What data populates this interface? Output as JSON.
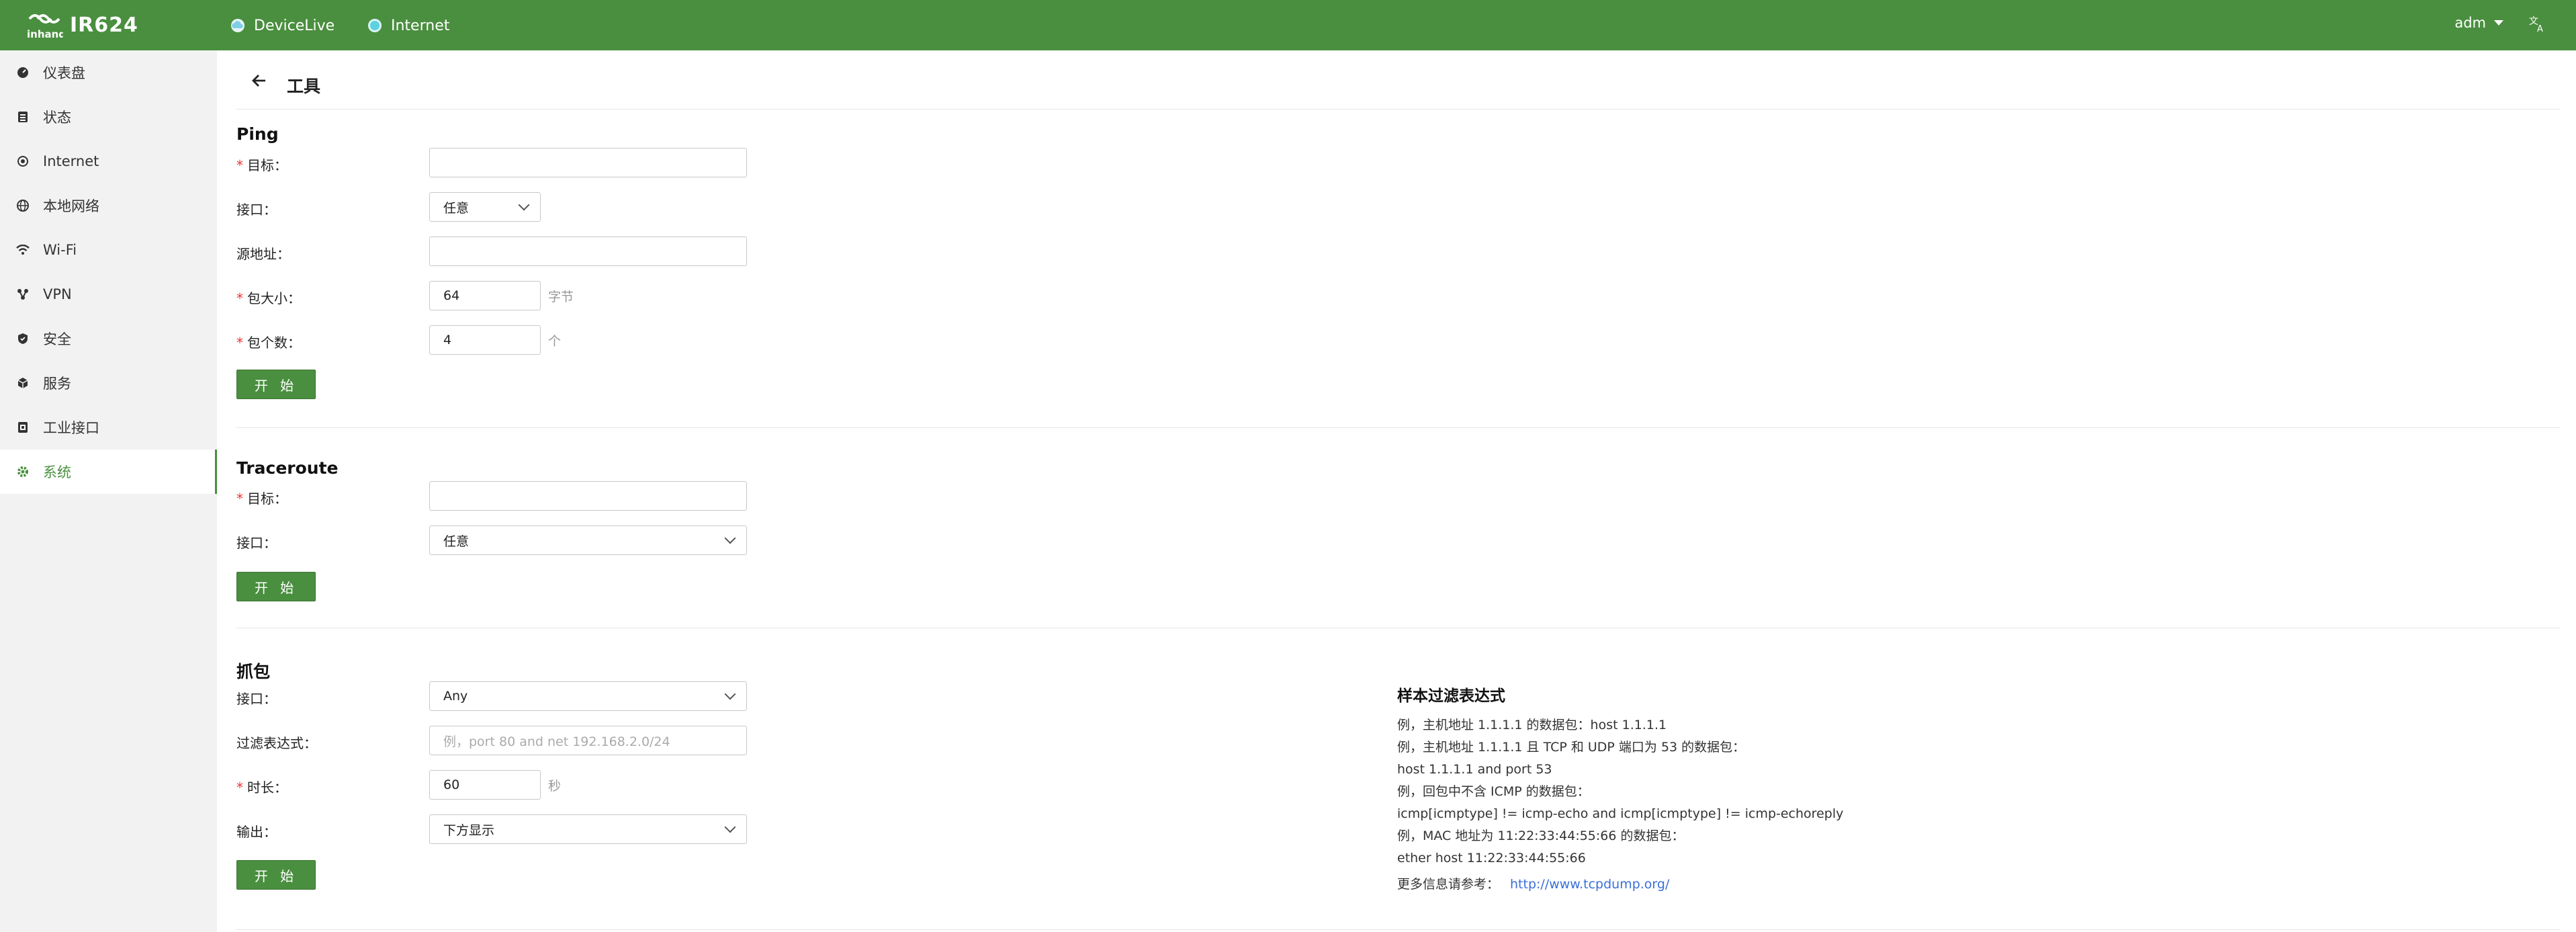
{
  "topbar": {
    "product": "IR624",
    "links": [
      {
        "label": "DeviceLive",
        "icon": "cloud-icon"
      },
      {
        "label": "Internet",
        "icon": "globe-status-icon"
      }
    ],
    "user": "adm",
    "lang_icon": "translate-icon",
    "colors": {
      "bar": "#4a8f3f",
      "cloud": "#7ecfe6",
      "internet_dot": "#5fd0e0"
    }
  },
  "sidebar": {
    "items": [
      {
        "label": "仪表盘",
        "icon": "dashboard-icon"
      },
      {
        "label": "状态",
        "icon": "status-icon"
      },
      {
        "label": "Internet",
        "icon": "internet-icon"
      },
      {
        "label": "本地网络",
        "icon": "lan-icon"
      },
      {
        "label": "Wi-Fi",
        "icon": "wifi-icon"
      },
      {
        "label": "VPN",
        "icon": "vpn-icon"
      },
      {
        "label": "安全",
        "icon": "shield-icon"
      },
      {
        "label": "服务",
        "icon": "service-icon"
      },
      {
        "label": "工业接口",
        "icon": "industrial-port-icon"
      },
      {
        "label": "系统",
        "icon": "gear-icon",
        "active": true
      }
    ]
  },
  "header": {
    "title": "工具"
  },
  "ping": {
    "title": "Ping",
    "target_label": "目标：",
    "target_value": "",
    "interface_label": "接口：",
    "interface_value": "任意",
    "source_label": "源地址：",
    "source_value": "",
    "size_label": "包大小：",
    "size_value": "64",
    "size_unit": "字节",
    "count_label": "包个数：",
    "count_value": "4",
    "count_unit": "个",
    "start": "开 始"
  },
  "traceroute": {
    "title": "Traceroute",
    "target_label": "目标：",
    "target_value": "",
    "interface_label": "接口：",
    "interface_value": "任意",
    "start": "开 始"
  },
  "capture": {
    "title": "抓包",
    "interface_label": "接口：",
    "interface_value": "Any",
    "filter_label": "过滤表达式：",
    "filter_placeholder": "例，port 80 and net 192.168.2.0/24",
    "duration_label": "时长：",
    "duration_value": "60",
    "duration_unit": "秒",
    "output_label": "输出：",
    "output_value": "下方显示",
    "start": "开 始"
  },
  "sample": {
    "title": "样本过滤表达式",
    "lines": [
      "例，主机地址 1.1.1.1 的数据包：host 1.1.1.1",
      "例，主机地址 1.1.1.1 且 TCP 和 UDP 端口为 53 的数据包：",
      "host 1.1.1.1 and port 53",
      "例，回包中不含 ICMP 的数据包：",
      "icmp[icmptype] != icmp-echo and icmp[icmptype] != icmp-echoreply",
      "例，MAC 地址为 11:22:33:44:55:66 的数据包：",
      "ether host 11:22:33:44:55:66"
    ],
    "more_label": "更多信息请参考：",
    "more_link": "http://www.tcpdump.org/"
  }
}
